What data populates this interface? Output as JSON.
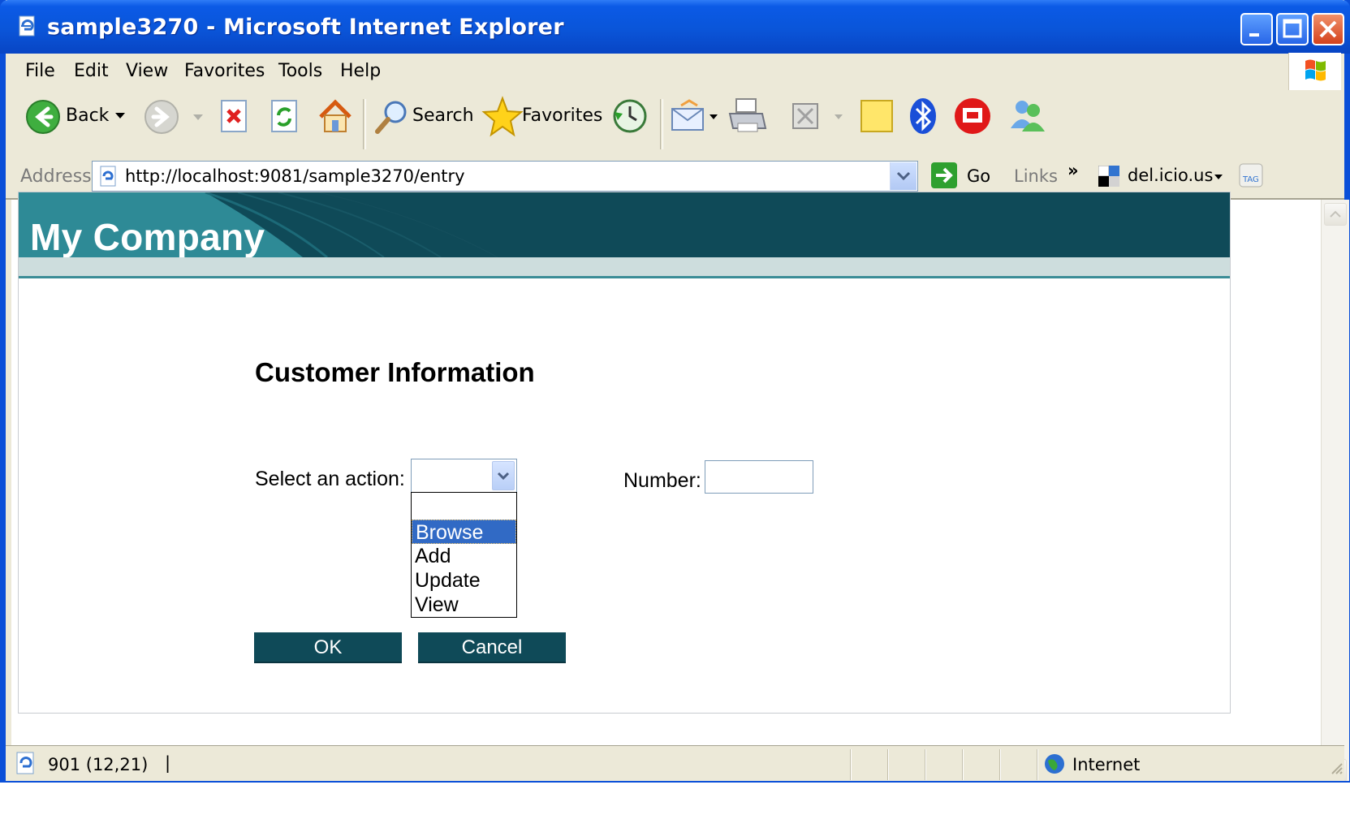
{
  "window": {
    "title": "sample3270 - Microsoft Internet Explorer"
  },
  "menubar": {
    "items": [
      "File",
      "Edit",
      "View",
      "Favorites",
      "Tools",
      "Help"
    ]
  },
  "toolbar": {
    "back_label": "Back",
    "search_label": "Search",
    "favorites_label": "Favorites"
  },
  "addressbar": {
    "label": "Address",
    "url": "http://localhost:9081/sample3270/entry",
    "go_label": "Go",
    "links_label": "Links",
    "links_more": "»",
    "bookmark_label": "del.icio.us"
  },
  "page": {
    "company": "My Company",
    "heading": "Customer Information",
    "action_label": "Select an action:",
    "number_label": "Number:",
    "number_value": "",
    "action_selected": "",
    "action_options": [
      "",
      "Browse",
      "Add",
      "Update",
      "View"
    ],
    "highlighted_option": "Browse",
    "ok_label": "OK",
    "cancel_label": "Cancel"
  },
  "statusbar": {
    "text": "901 (12,21)",
    "cursor": "|",
    "zone": "Internet"
  },
  "colors": {
    "banner": "#0f4a58",
    "button": "#0f4a58",
    "highlight": "#316ac5",
    "titlebar": "#0a55d9"
  }
}
